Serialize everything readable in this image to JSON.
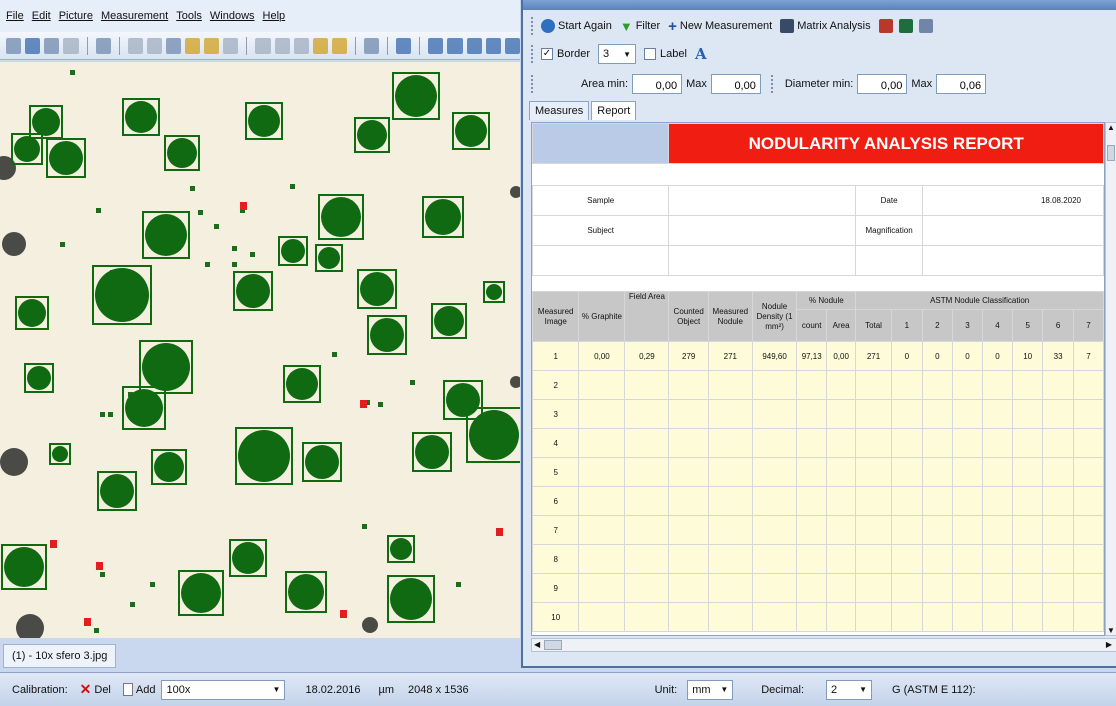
{
  "menu": [
    "File",
    "Edit",
    "Picture",
    "Measurement",
    "Tools",
    "Windows",
    "Help"
  ],
  "document_tab": "(1) - 10x sfero 3.jpg",
  "status": {
    "calibration_label": "Calibration:",
    "del_label": "Del",
    "add_label": "Add",
    "calibration_value": "100x",
    "date": "18.02.2016",
    "unit_short": "µm",
    "image_size": "2048 x 1536",
    "unit_label": "Unit:",
    "unit_value": "mm",
    "decimal_label": "Decimal:",
    "decimal_value": "2",
    "standard": "G (ASTM E 112):"
  },
  "toolbar": {
    "start_again": "Start Again",
    "filter": "Filter",
    "new_measurement": "New Measurement",
    "matrix_analysis": "Matrix Analysis",
    "border_label": "Border",
    "border_checked": true,
    "border_value": "3",
    "label_label": "Label",
    "label_checked": false,
    "area_min_label": "Area min:",
    "area_min": "0,00",
    "area_max_label": "Max",
    "area_max": "0,00",
    "diameter_min_label": "Diameter min:",
    "diameter_min": "0,00",
    "diameter_max_label": "Max",
    "diameter_max": "0,06"
  },
  "tabs": [
    "Measures",
    "Report"
  ],
  "report": {
    "title": "NODULARITY ANALYSIS REPORT",
    "sample_label": "Sample",
    "date_label": "Date",
    "date_value": "18.08.2020",
    "subject_label": "Subject",
    "magnification_label": "Magnification",
    "headers": [
      "Measured Image",
      "% Graphite",
      "Field Area",
      "Counted Object",
      "Measured Nodule",
      "Nodule Density (1 mm²)",
      "count",
      "Area",
      "Total",
      "1",
      "2",
      "3",
      "4",
      "5",
      "6",
      "7"
    ],
    "pct_nodule_header": "% Nodule",
    "astm_header": "ASTM Nodule Classification",
    "rows": [
      [
        "1",
        "0,00",
        "0,29",
        "279",
        "271",
        "949,60",
        "97,13",
        "0,00",
        "271",
        "0",
        "0",
        "0",
        "0",
        "10",
        "33",
        "7"
      ],
      [
        "2"
      ],
      [
        "3"
      ],
      [
        "4"
      ],
      [
        "5"
      ],
      [
        "6"
      ],
      [
        "7"
      ],
      [
        "8"
      ],
      [
        "9"
      ],
      [
        "10"
      ]
    ]
  }
}
